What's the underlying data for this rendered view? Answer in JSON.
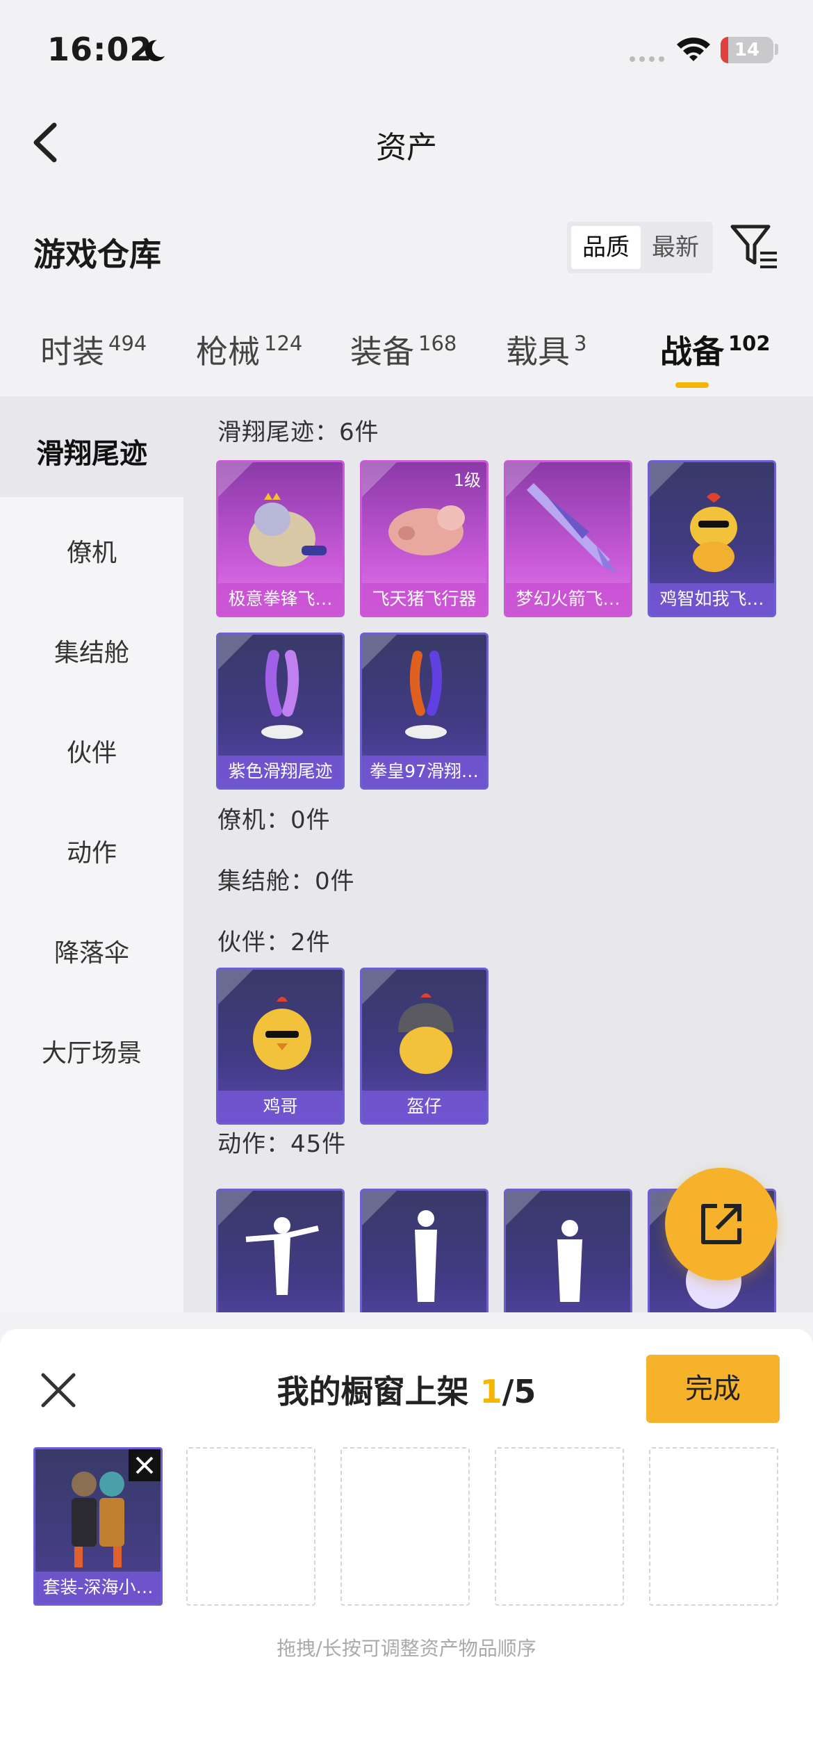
{
  "status": {
    "time": "16:02",
    "battery": "14",
    "battery_level": 0.14
  },
  "nav": {
    "title": "资产"
  },
  "section": {
    "title": "游戏仓库",
    "sort_options": [
      "品质",
      "最新"
    ],
    "sort_selected": "品质"
  },
  "tabs": [
    {
      "label": "时装",
      "count": "494"
    },
    {
      "label": "枪械",
      "count": "124"
    },
    {
      "label": "装备",
      "count": "168"
    },
    {
      "label": "载具",
      "count": "3"
    },
    {
      "label": "战备",
      "count": "102",
      "active": true
    }
  ],
  "sidebar": {
    "items": [
      "滑翔尾迹",
      "僚机",
      "集结舱",
      "伙伴",
      "动作",
      "降落伞",
      "大厅场景"
    ],
    "active": "滑翔尾迹"
  },
  "groups": {
    "g1": "滑翔尾迹：6件",
    "g2": "僚机：0件",
    "g3": "集结舱：0件",
    "g4": "伙伴：2件",
    "g5": "动作：45件"
  },
  "glide_items": [
    {
      "name": "极意拳锋飞…",
      "badge": ""
    },
    {
      "name": "飞天猪飞行器",
      "badge": "1级"
    },
    {
      "name": "梦幻火箭飞…",
      "badge": ""
    },
    {
      "name": "鸡智如我飞…",
      "badge": ""
    },
    {
      "name": "紫色滑翔尾迹",
      "badge": ""
    },
    {
      "name": "拳皇97滑翔…",
      "badge": ""
    }
  ],
  "partner_items": [
    {
      "name": "鸡哥"
    },
    {
      "name": "盔仔"
    }
  ],
  "showcase": {
    "title_prefix": "我的橱窗上架 ",
    "count": "1",
    "total": "/5",
    "done_label": "完成",
    "slot1_label": "套装-深海小…",
    "hint": "拖拽/长按可调整资产物品顺序"
  },
  "colors": {
    "accent": "#f5b22a",
    "purple": "#6e5fd0",
    "pink": "#c95bd6"
  }
}
